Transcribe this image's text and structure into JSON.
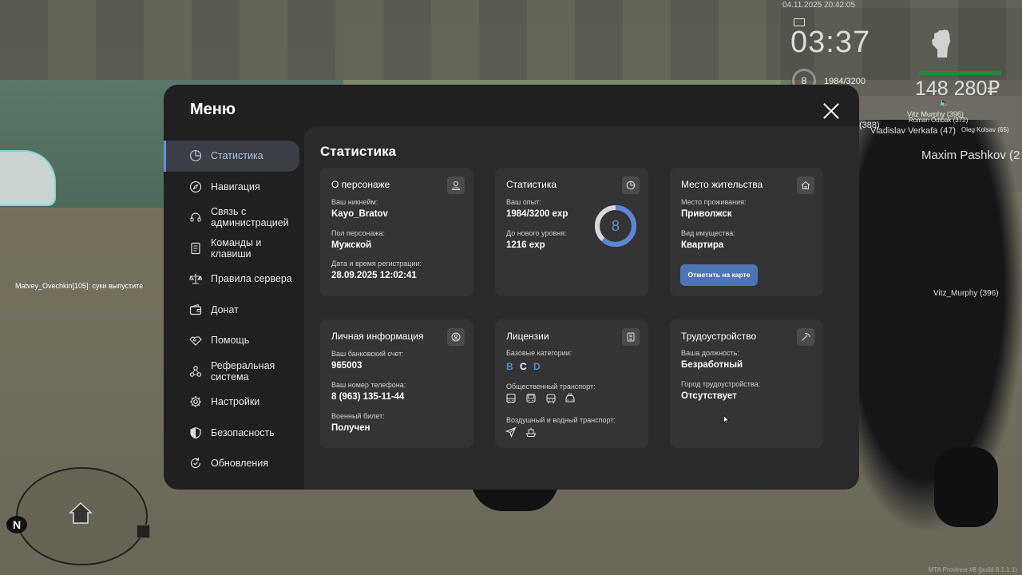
{
  "hud": {
    "datetime": "04.11.2025 20:42:05",
    "time": "03:37",
    "level": "8",
    "exp": "1984/3200",
    "money": "148 280₽"
  },
  "nametags": [
    {
      "text": "Vitz Murphy (396)"
    },
    {
      "text": "Roman Odibak (372)"
    },
    {
      "text": "(388)"
    },
    {
      "text": "Vladislav Verkafa (47)"
    },
    {
      "text": "Oleg Kolsav (65)"
    },
    {
      "text": "Maxim Pashkov (2"
    },
    {
      "text": "Vitz_Murphy (396)"
    }
  ],
  "chat": "Matvey_Ovechkin[105]: суки выпустите",
  "radar": {
    "north": "N"
  },
  "footer": "MTA Province #8 (build 8.1.1.1)",
  "menu": {
    "title": "Меню",
    "sidebar": [
      {
        "label": "Статистика",
        "icon": "pie-chart-icon"
      },
      {
        "label": "Навигация",
        "icon": "compass-icon"
      },
      {
        "label": "Связь с администрацией",
        "icon": "headset-icon"
      },
      {
        "label": "Команды и клавиши",
        "icon": "document-icon"
      },
      {
        "label": "Правила сервера",
        "icon": "scales-icon"
      },
      {
        "label": "Донат",
        "icon": "wallet-icon"
      },
      {
        "label": "Помощь",
        "icon": "handshake-icon"
      },
      {
        "label": "Реферальная система",
        "icon": "network-icon"
      },
      {
        "label": "Настройки",
        "icon": "gear-icon"
      },
      {
        "label": "Безопасность",
        "icon": "shield-icon"
      },
      {
        "label": "Обновления",
        "icon": "refresh-icon"
      }
    ],
    "content_title": "Статистика",
    "cards": {
      "character": {
        "title": "О персонаже",
        "nick_label": "Ваш никнейм:",
        "nick": "Kayo_Bratov",
        "gender_label": "Пол персонажа:",
        "gender": "Мужской",
        "reg_label": "Дата и время регистрации:",
        "reg": "28.09.2025 12:02:41"
      },
      "stats": {
        "title": "Статистика",
        "exp_label": "Ваш опыт:",
        "exp": "1984/3200 exp",
        "next_label": "До нового уровня:",
        "next": "1216 exp",
        "level": "8",
        "exp_current": 1984,
        "exp_max": 3200
      },
      "residence": {
        "title": "Место жительства",
        "place_label": "Место проживания:",
        "place": "Приволжск",
        "type_label": "Вид имущества:",
        "type": "Квартира",
        "button": "Отметить на карте"
      },
      "personal": {
        "title": "Личная информация",
        "bank_label": "Ваш банковский счет:",
        "bank": "965003",
        "phone_label": "Ваш номер телефона:",
        "phone": "8 (963) 135-11-44",
        "military_label": "Военный билет:",
        "military": "Получен"
      },
      "licenses": {
        "title": "Лицензии",
        "base_label": "Базовые категории:",
        "categories": [
          {
            "name": "B",
            "color": "#5a86d6"
          },
          {
            "name": "C",
            "color": "#ffffff"
          },
          {
            "name": "D",
            "color": "#5a86d6"
          }
        ],
        "public_label": "Общественный транспорт:",
        "air_label": "Воздушный и водный транспорт:"
      },
      "employment": {
        "title": "Трудоустройство",
        "position_label": "Ваша должность:",
        "position": "Безработный",
        "city_label": "Город трудоустройства:",
        "city": "Отсутствует"
      }
    }
  },
  "colors": {
    "accent": "#5073b3",
    "ring": "#6a8ed1",
    "panel": "#202022",
    "card": "#343436"
  }
}
